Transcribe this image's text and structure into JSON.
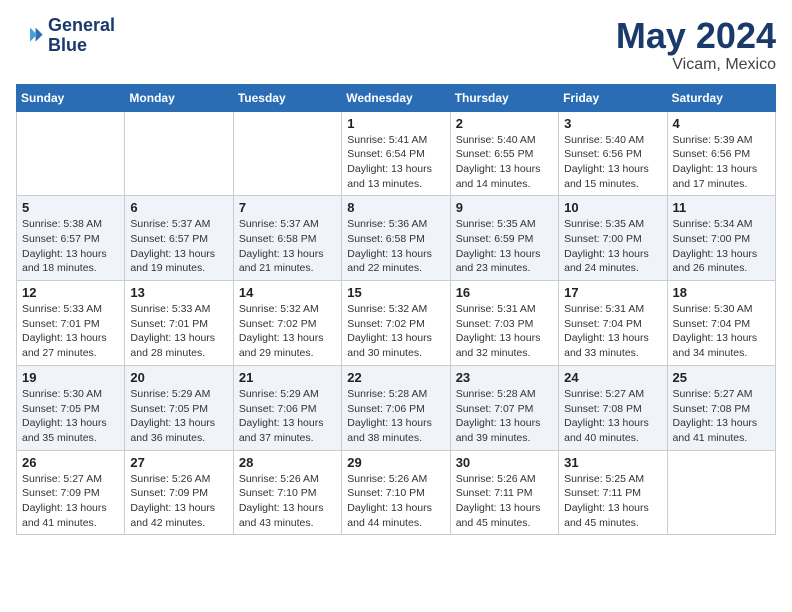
{
  "header": {
    "logo_line1": "General",
    "logo_line2": "Blue",
    "title": "May 2024",
    "subtitle": "Vicam, Mexico"
  },
  "calendar": {
    "weekdays": [
      "Sunday",
      "Monday",
      "Tuesday",
      "Wednesday",
      "Thursday",
      "Friday",
      "Saturday"
    ],
    "weeks": [
      [
        {
          "day": "",
          "info": ""
        },
        {
          "day": "",
          "info": ""
        },
        {
          "day": "",
          "info": ""
        },
        {
          "day": "1",
          "info": "Sunrise: 5:41 AM\nSunset: 6:54 PM\nDaylight: 13 hours and 13 minutes."
        },
        {
          "day": "2",
          "info": "Sunrise: 5:40 AM\nSunset: 6:55 PM\nDaylight: 13 hours and 14 minutes."
        },
        {
          "day": "3",
          "info": "Sunrise: 5:40 AM\nSunset: 6:56 PM\nDaylight: 13 hours and 15 minutes."
        },
        {
          "day": "4",
          "info": "Sunrise: 5:39 AM\nSunset: 6:56 PM\nDaylight: 13 hours and 17 minutes."
        }
      ],
      [
        {
          "day": "5",
          "info": "Sunrise: 5:38 AM\nSunset: 6:57 PM\nDaylight: 13 hours and 18 minutes."
        },
        {
          "day": "6",
          "info": "Sunrise: 5:37 AM\nSunset: 6:57 PM\nDaylight: 13 hours and 19 minutes."
        },
        {
          "day": "7",
          "info": "Sunrise: 5:37 AM\nSunset: 6:58 PM\nDaylight: 13 hours and 21 minutes."
        },
        {
          "day": "8",
          "info": "Sunrise: 5:36 AM\nSunset: 6:58 PM\nDaylight: 13 hours and 22 minutes."
        },
        {
          "day": "9",
          "info": "Sunrise: 5:35 AM\nSunset: 6:59 PM\nDaylight: 13 hours and 23 minutes."
        },
        {
          "day": "10",
          "info": "Sunrise: 5:35 AM\nSunset: 7:00 PM\nDaylight: 13 hours and 24 minutes."
        },
        {
          "day": "11",
          "info": "Sunrise: 5:34 AM\nSunset: 7:00 PM\nDaylight: 13 hours and 26 minutes."
        }
      ],
      [
        {
          "day": "12",
          "info": "Sunrise: 5:33 AM\nSunset: 7:01 PM\nDaylight: 13 hours and 27 minutes."
        },
        {
          "day": "13",
          "info": "Sunrise: 5:33 AM\nSunset: 7:01 PM\nDaylight: 13 hours and 28 minutes."
        },
        {
          "day": "14",
          "info": "Sunrise: 5:32 AM\nSunset: 7:02 PM\nDaylight: 13 hours and 29 minutes."
        },
        {
          "day": "15",
          "info": "Sunrise: 5:32 AM\nSunset: 7:02 PM\nDaylight: 13 hours and 30 minutes."
        },
        {
          "day": "16",
          "info": "Sunrise: 5:31 AM\nSunset: 7:03 PM\nDaylight: 13 hours and 32 minutes."
        },
        {
          "day": "17",
          "info": "Sunrise: 5:31 AM\nSunset: 7:04 PM\nDaylight: 13 hours and 33 minutes."
        },
        {
          "day": "18",
          "info": "Sunrise: 5:30 AM\nSunset: 7:04 PM\nDaylight: 13 hours and 34 minutes."
        }
      ],
      [
        {
          "day": "19",
          "info": "Sunrise: 5:30 AM\nSunset: 7:05 PM\nDaylight: 13 hours and 35 minutes."
        },
        {
          "day": "20",
          "info": "Sunrise: 5:29 AM\nSunset: 7:05 PM\nDaylight: 13 hours and 36 minutes."
        },
        {
          "day": "21",
          "info": "Sunrise: 5:29 AM\nSunset: 7:06 PM\nDaylight: 13 hours and 37 minutes."
        },
        {
          "day": "22",
          "info": "Sunrise: 5:28 AM\nSunset: 7:06 PM\nDaylight: 13 hours and 38 minutes."
        },
        {
          "day": "23",
          "info": "Sunrise: 5:28 AM\nSunset: 7:07 PM\nDaylight: 13 hours and 39 minutes."
        },
        {
          "day": "24",
          "info": "Sunrise: 5:27 AM\nSunset: 7:08 PM\nDaylight: 13 hours and 40 minutes."
        },
        {
          "day": "25",
          "info": "Sunrise: 5:27 AM\nSunset: 7:08 PM\nDaylight: 13 hours and 41 minutes."
        }
      ],
      [
        {
          "day": "26",
          "info": "Sunrise: 5:27 AM\nSunset: 7:09 PM\nDaylight: 13 hours and 41 minutes."
        },
        {
          "day": "27",
          "info": "Sunrise: 5:26 AM\nSunset: 7:09 PM\nDaylight: 13 hours and 42 minutes."
        },
        {
          "day": "28",
          "info": "Sunrise: 5:26 AM\nSunset: 7:10 PM\nDaylight: 13 hours and 43 minutes."
        },
        {
          "day": "29",
          "info": "Sunrise: 5:26 AM\nSunset: 7:10 PM\nDaylight: 13 hours and 44 minutes."
        },
        {
          "day": "30",
          "info": "Sunrise: 5:26 AM\nSunset: 7:11 PM\nDaylight: 13 hours and 45 minutes."
        },
        {
          "day": "31",
          "info": "Sunrise: 5:25 AM\nSunset: 7:11 PM\nDaylight: 13 hours and 45 minutes."
        },
        {
          "day": "",
          "info": ""
        }
      ]
    ]
  }
}
